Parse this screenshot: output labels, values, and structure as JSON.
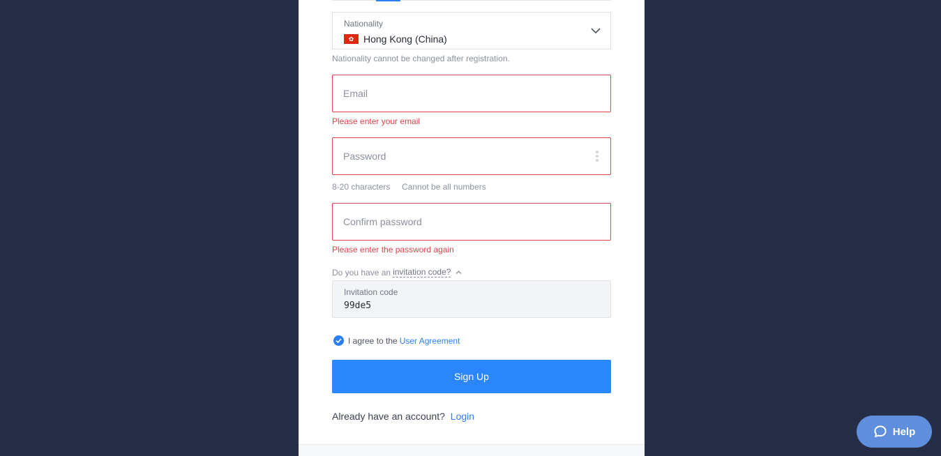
{
  "form": {
    "nationality": {
      "label": "Nationality",
      "value": "Hong Kong (China)",
      "flag_color": "#de2910",
      "icon": "chevron-down-icon",
      "hint": "Nationality cannot be changed after registration."
    },
    "email": {
      "placeholder": "Email",
      "error": "Please enter your email"
    },
    "password": {
      "placeholder": "Password",
      "rule_1": "8-20 characters",
      "rule_2": "Cannot be all numbers",
      "icon": "password-visibility-icon"
    },
    "confirm_password": {
      "placeholder": "Confirm password",
      "error": "Please enter the password again"
    },
    "invitation": {
      "question_prefix": "Do you have an",
      "question_link": "invitation code?",
      "label": "Invitation code",
      "value": "99de5"
    },
    "agreement": {
      "text": "I agree to the",
      "link": "User Agreement",
      "checked": true
    },
    "signup_label": "Sign Up",
    "login": {
      "prompt": "Already have an account?",
      "link": "Login"
    }
  },
  "help_button": {
    "label": "Help",
    "icon": "chat-bubble-icon"
  },
  "colors": {
    "background": "#252d47",
    "accent": "#2b85fb",
    "error": "#e3424b",
    "help": "#5f8fdc"
  }
}
